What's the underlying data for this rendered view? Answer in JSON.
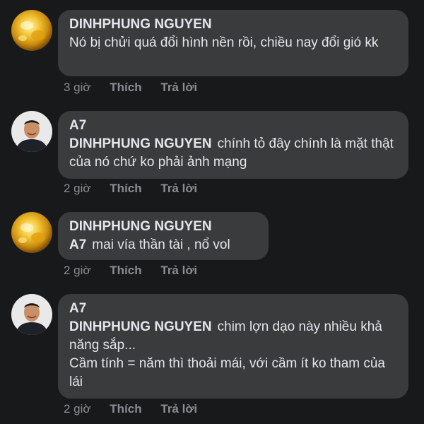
{
  "comments": [
    {
      "avatar": "gold-avatar-icon",
      "author": "DINHPHUNG NGUYEN",
      "mention": "",
      "text": "Nó bị chửi quá đổi hình nền rồi, chiều nay đổi gió kk",
      "time": "3 giờ",
      "like_label": "Thích",
      "reply_label": "Trả lời"
    },
    {
      "avatar": "man-avatar-icon",
      "author": "A7",
      "mention": "DINHPHUNG NGUYEN",
      "text": "chính tỏ đây chính là mặt thật của nó chứ ko phải ảnh mạng",
      "time": "2 giờ",
      "like_label": "Thích",
      "reply_label": "Trả lời"
    },
    {
      "avatar": "gold-avatar-icon",
      "author": "DINHPHUNG NGUYEN",
      "mention": "A7",
      "text": "mai vía thần tài , nổ vol",
      "time": "2 giờ",
      "like_label": "Thích",
      "reply_label": "Trả lời"
    },
    {
      "avatar": "man-avatar-icon",
      "author": "A7",
      "mention": "DINHPHUNG NGUYEN",
      "text": "chim lợn dạo này nhiều khả năng sắp...",
      "text2": "Cầm tính = năm thì thoải mái, với cầm ít ko tham của lái",
      "time": "2 giờ",
      "like_label": "Thích",
      "reply_label": "Trả lời"
    }
  ],
  "colors": {
    "background": "#18191a",
    "bubble": "#3a3b3c",
    "text": "#e4e6eb",
    "meta": "#8a8d91"
  }
}
